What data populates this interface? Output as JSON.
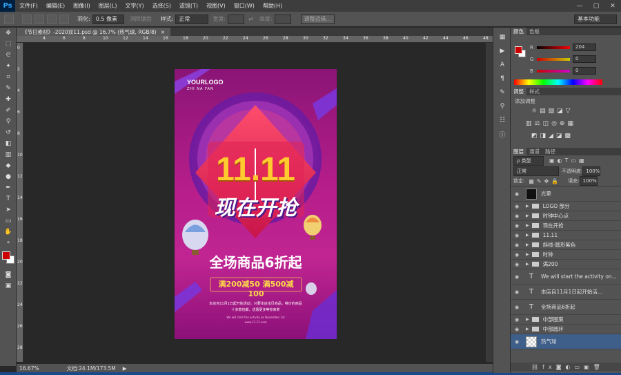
{
  "app": {
    "logo": "Ps"
  },
  "menu": [
    "文件(F)",
    "编辑(E)",
    "图像(I)",
    "图层(L)",
    "文字(Y)",
    "选择(S)",
    "滤镜(T)",
    "视图(V)",
    "窗口(W)",
    "帮助(H)"
  ],
  "window_controls": [
    "—",
    "□",
    "✕"
  ],
  "options": {
    "feather_label": "羽化:",
    "feather_value": "0.5 像素",
    "antialias_label": "消除锯齿",
    "style_label": "样式:",
    "style_value": "正常",
    "width_label": "宽度:",
    "height_label": "高度:",
    "refine_button": "调整边缘...",
    "workspace": "基本功能"
  },
  "document": {
    "tab_title": "《节日素材》-2020双11.psd @ 16.7% (热气球, RGB/8)",
    "close": "×"
  },
  "status": {
    "zoom": "16.67%",
    "doc_size": "文档:24.1M/173.5M"
  },
  "poster": {
    "logo": "YOURLOGO",
    "logo_sub": "ZHI NA FAN",
    "big_number": "11.11",
    "headline": "现在开抢",
    "discount_line": "全场商品6折起",
    "coupon": "满200减50  满500减100",
    "info1": "本店自11月1日起开始活动，只要本店宝贝商品，特价的商品",
    "info2": "十多款包邮，优惠更多等你来拿",
    "info3": "We will start the activity on November 1st",
    "info4": "www.11.11.com"
  },
  "panels": {
    "color_tabs": [
      "颜色",
      "色板"
    ],
    "color": {
      "r_label": "R",
      "g_label": "G",
      "b_label": "B",
      "r": "204",
      "g": "0",
      "b": "0",
      "fg": "#cc0000"
    },
    "adjust_tabs": [
      "调整",
      "样式"
    ],
    "adjust_title": "添加调整",
    "layer_tabs": [
      "图层",
      "通道",
      "路径"
    ],
    "kind_label": "ρ 类型",
    "blend_mode": "正常",
    "opacity_label": "不透明度:",
    "opacity_value": "100%",
    "lock_label": "锁定:",
    "fill_label": "填充:",
    "fill_value": "100%",
    "layers": [
      {
        "name": "光晕",
        "kind": "image"
      },
      {
        "name": "LOGO 部分",
        "kind": "group"
      },
      {
        "name": "时钟中心点",
        "kind": "group"
      },
      {
        "name": "现在开抢",
        "kind": "group"
      },
      {
        "name": "11.11",
        "kind": "group"
      },
      {
        "name": "斜线-圆形紫色",
        "kind": "group"
      },
      {
        "name": "时钟",
        "kind": "group"
      },
      {
        "name": "满200",
        "kind": "group"
      },
      {
        "name": "We will start the activity on...",
        "kind": "text"
      },
      {
        "name": "本店自11月1日起开始活...",
        "kind": "text"
      },
      {
        "name": "全场商品6折起",
        "kind": "text"
      },
      {
        "name": "中部图案",
        "kind": "group"
      },
      {
        "name": "中部圆环",
        "kind": "group"
      },
      {
        "name": "热气球",
        "kind": "image",
        "selected": true
      }
    ]
  }
}
